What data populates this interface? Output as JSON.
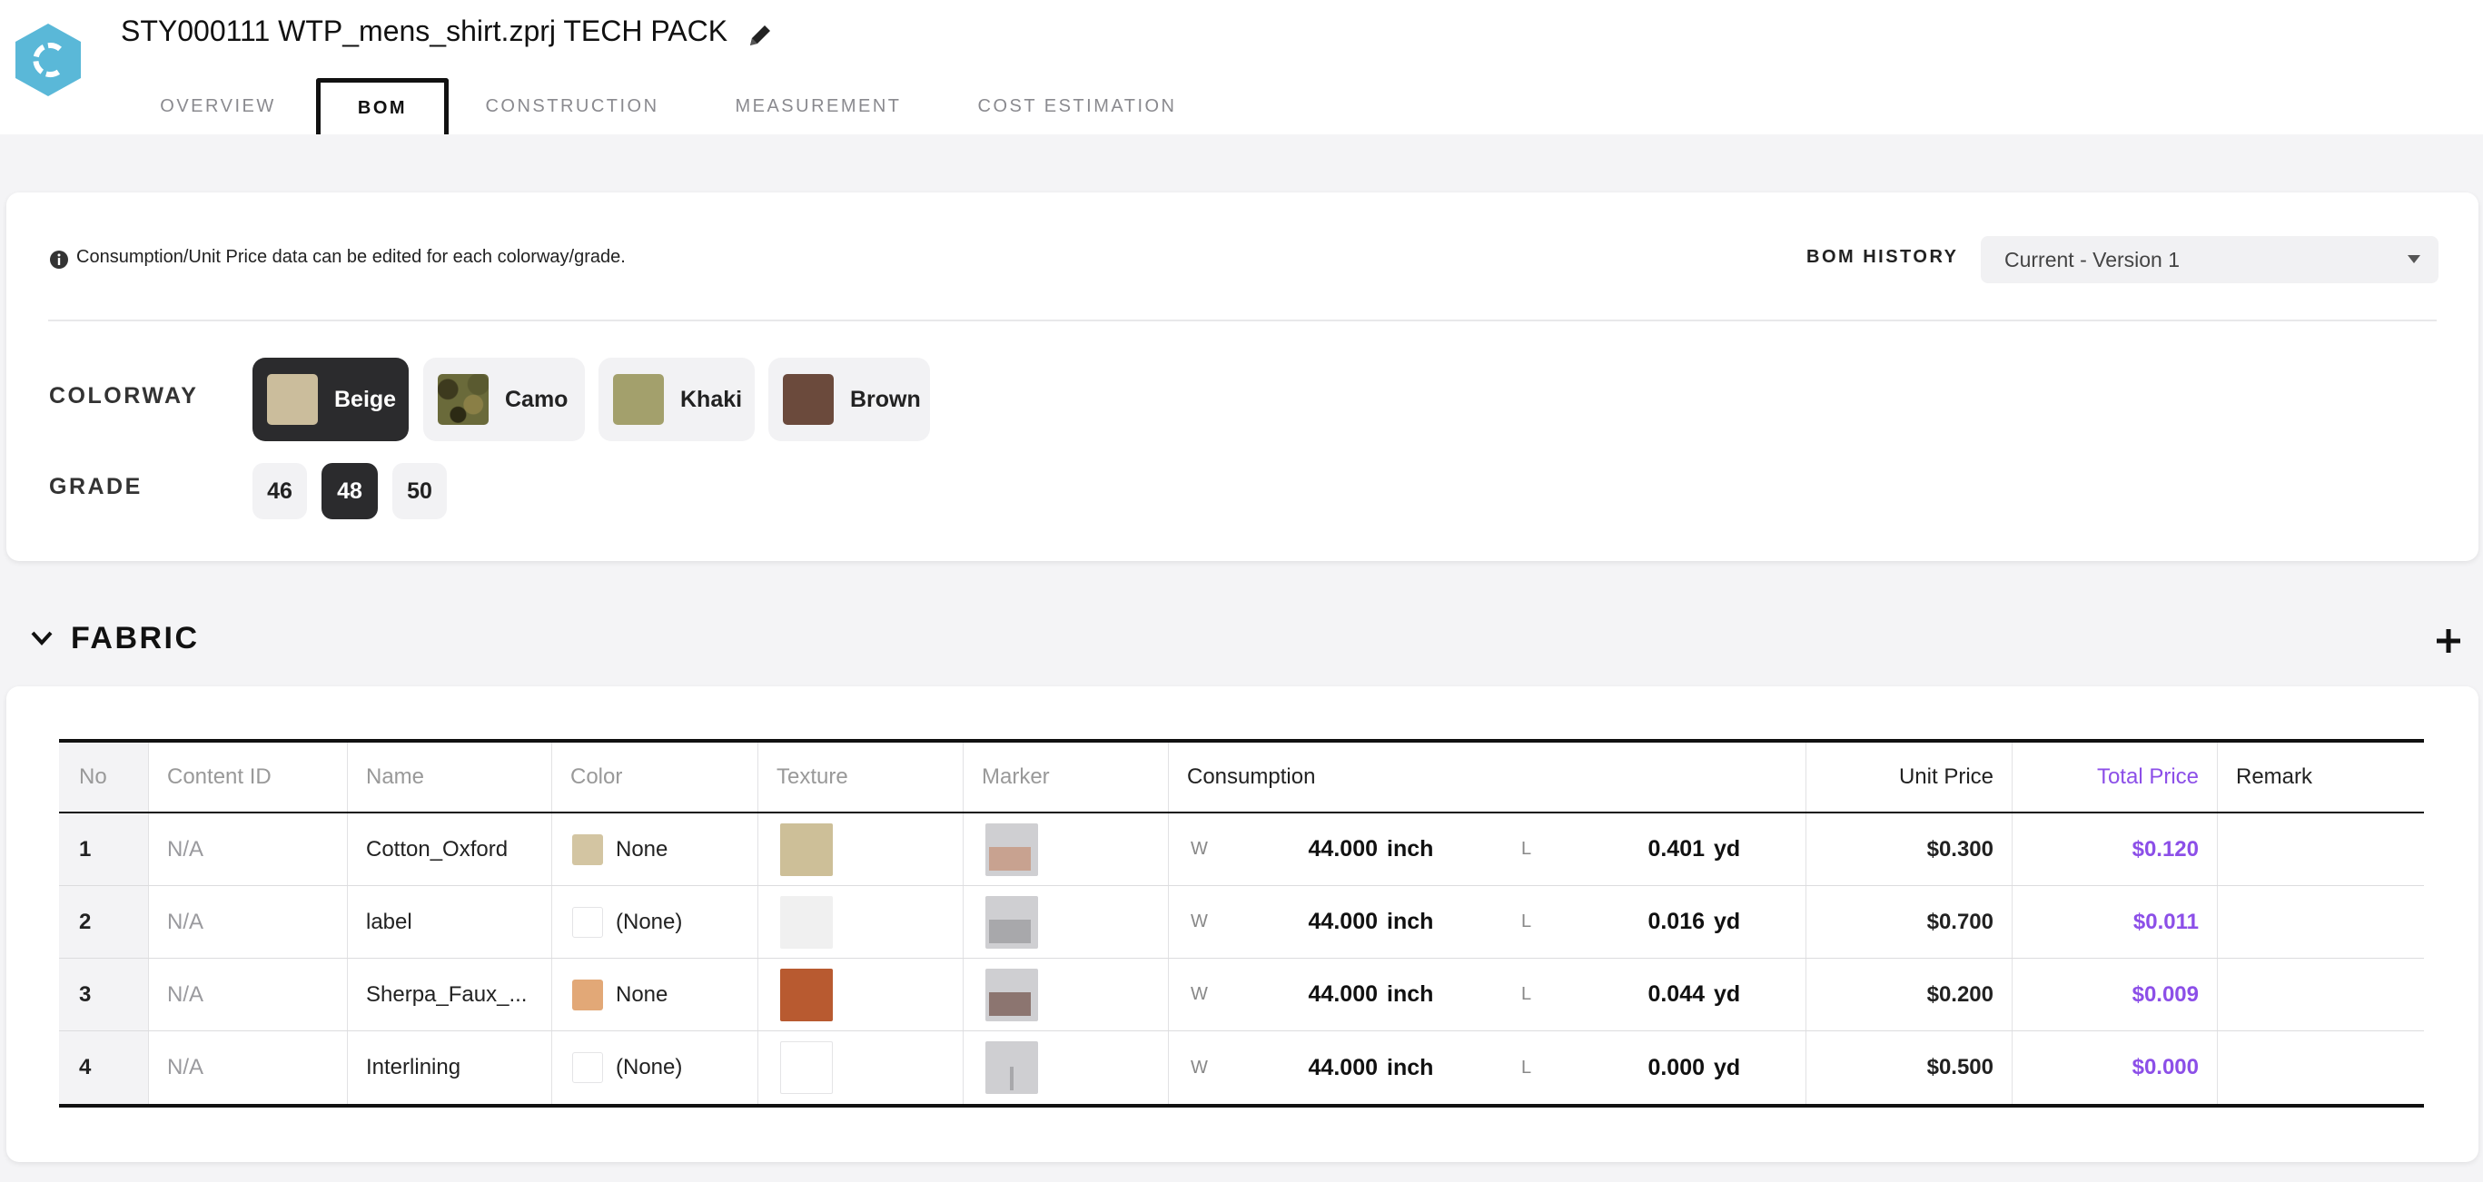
{
  "header": {
    "title": "STY000111 WTP_mens_shirt.zprj TECH PACK",
    "tabs": [
      "OVERVIEW",
      "BOM",
      "CONSTRUCTION",
      "MEASUREMENT",
      "COST ESTIMATION"
    ],
    "active_tab": "BOM"
  },
  "bom": {
    "info_text": "Consumption/Unit Price data can be edited for each colorway/grade.",
    "history_label": "BOM HISTORY",
    "history_value": "Current - Version 1",
    "colorway_label": "COLORWAY",
    "colorways": [
      {
        "name": "Beige",
        "color": "#cbbd9c",
        "selected": true
      },
      {
        "name": "Camo",
        "color": "#6a6a3a",
        "selected": false
      },
      {
        "name": "Khaki",
        "color": "#a3a06c",
        "selected": false
      },
      {
        "name": "Brown",
        "color": "#6b4a3c",
        "selected": false
      }
    ],
    "grade_label": "GRADE",
    "grades": [
      "46",
      "48",
      "50"
    ],
    "selected_grade": "48"
  },
  "fabric": {
    "title": "FABRIC",
    "columns": [
      "No",
      "Content ID",
      "Name",
      "Color",
      "Texture",
      "Marker",
      "Consumption",
      "Unit Price",
      "Total Price",
      "Remark"
    ],
    "rows": [
      {
        "no": "1",
        "content_id": "N/A",
        "name": "Cotton_Oxford",
        "color_label": "None",
        "color_hex": "#d3c5a2",
        "texture_color": "#cdbf98",
        "w_label": "W",
        "w_value": "44.000",
        "w_unit": "inch",
        "l_label": "L",
        "l_value": "0.401",
        "l_unit": "yd",
        "unit_price": "$0.300",
        "total_price": "$0.120",
        "remark": ""
      },
      {
        "no": "2",
        "content_id": "N/A",
        "name": "label",
        "color_label": "(None)",
        "color_hex": "#ffffff",
        "texture_color": "#f0f0f0",
        "w_label": "W",
        "w_value": "44.000",
        "w_unit": "inch",
        "l_label": "L",
        "l_value": "0.016",
        "l_unit": "yd",
        "unit_price": "$0.700",
        "total_price": "$0.011",
        "remark": ""
      },
      {
        "no": "3",
        "content_id": "N/A",
        "name": "Sherpa_Faux_...",
        "color_label": "None",
        "color_hex": "#e2a877",
        "texture_color": "#b85a30",
        "w_label": "W",
        "w_value": "44.000",
        "w_unit": "inch",
        "l_label": "L",
        "l_value": "0.044",
        "l_unit": "yd",
        "unit_price": "$0.200",
        "total_price": "$0.009",
        "remark": ""
      },
      {
        "no": "4",
        "content_id": "N/A",
        "name": "Interlining",
        "color_label": "(None)",
        "color_hex": "#ffffff",
        "texture_color": "#ffffff",
        "w_label": "W",
        "w_value": "44.000",
        "w_unit": "inch",
        "l_label": "L",
        "l_value": "0.000",
        "l_unit": "yd",
        "unit_price": "$0.500",
        "total_price": "$0.000",
        "remark": ""
      }
    ]
  },
  "colors": {
    "accent_purple": "#8c4fe8",
    "selected_chip": "#2b2b2d",
    "logo": "#5ab8d8"
  }
}
